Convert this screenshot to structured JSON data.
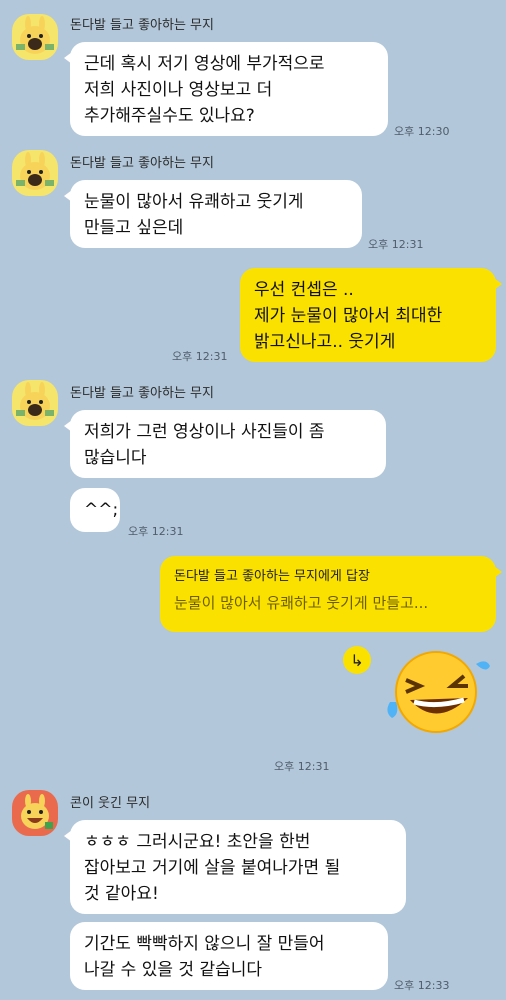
{
  "messages": {
    "sender1": "돈다발 들고 좋아하는 무지",
    "m1_l1": "근데 혹시 저기 영상에 부가적으로",
    "m1_l2": "저희 사진이나 영상보고 더",
    "m1_l3": "추가해주실수도 있나요?",
    "t1": "오후 12:30",
    "m2_l1": "눈물이 많아서 유쾌하고 웃기게",
    "m2_l2": "만들고 싶은데",
    "t2": "오후 12:31",
    "r1_l1": "우선 컨셉은 ..",
    "r1_l2": "제가 눈물이 많아서 최대한",
    "r1_l3": "밝고신나고.. 웃기게",
    "t3": "오후 12:31",
    "m3_l1": "저희가 그런 영상이나 사진들이 좀",
    "m3_l2": "많습니다",
    "m4": "^^;",
    "t4": "오후 12:31",
    "reply_head": "돈다발 들고 좋아하는 무지에게 답장",
    "reply_quote": "눈물이 많아서 유쾌하고 웃기게 만들고...",
    "reply_btn_glyph": "↳",
    "t5": "오후 12:31",
    "sender2": "콘이 웃긴 무지",
    "m5_l1": "ㅎㅎㅎ 그러시군요! 초안을 한번",
    "m5_l2": "잡아보고 거기에 살을 붙여나가면 될",
    "m5_l3": "것 같아요!",
    "m6_l1": "기간도 빡빡하지 않으니 잘 만들어",
    "m6_l2": "나갈 수 있을 것 같습니다",
    "t6": "오후 12:33"
  },
  "colors": {
    "background": "#b2c7da",
    "my_bubble": "#fae100",
    "other_bubble": "#ffffff"
  },
  "icons": [
    "muji-money-avatar",
    "muji-laughing-avatar",
    "rolling-laughing-emoji",
    "reply-arrow-icon"
  ]
}
